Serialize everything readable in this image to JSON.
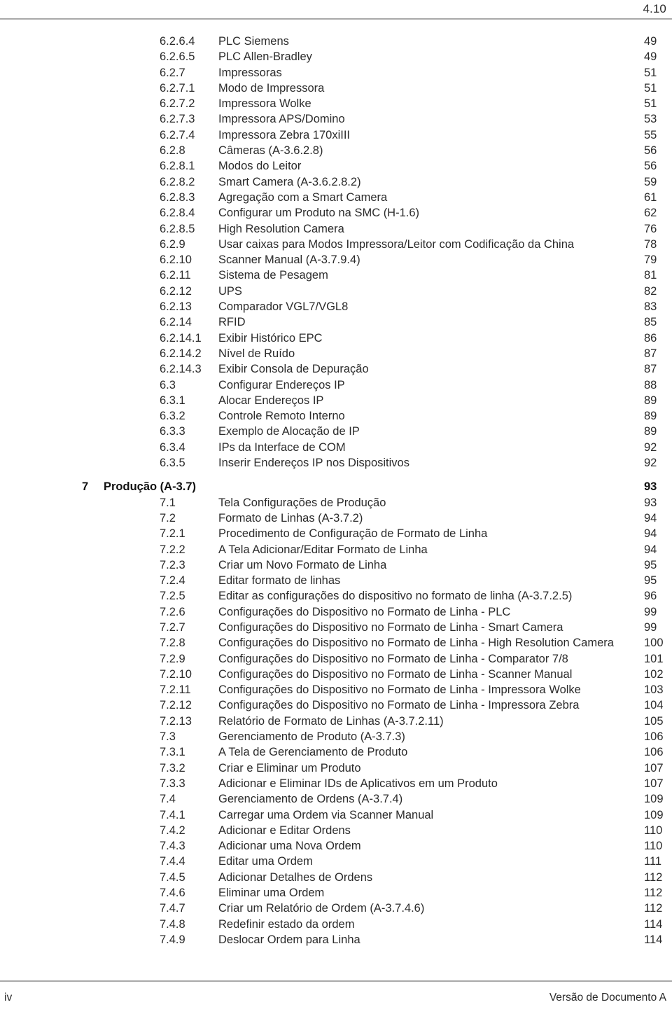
{
  "header": {
    "section_number": "4.10"
  },
  "footer": {
    "page_label": "iv",
    "document_version": "Versão de Documento A"
  },
  "toc": {
    "entries": [
      {
        "number": "6.2.6.4",
        "title": "PLC Siemens",
        "page": "49",
        "level": "entry"
      },
      {
        "number": "6.2.6.5",
        "title": "PLC Allen-Bradley",
        "page": "49",
        "level": "entry"
      },
      {
        "number": "6.2.7",
        "title": "Impressoras",
        "page": "51",
        "level": "entry"
      },
      {
        "number": "6.2.7.1",
        "title": "Modo de Impressora",
        "page": "51",
        "level": "entry"
      },
      {
        "number": "6.2.7.2",
        "title": "Impressora Wolke",
        "page": "51",
        "level": "entry"
      },
      {
        "number": "6.2.7.3",
        "title": "Impressora APS/Domino",
        "page": "53",
        "level": "entry"
      },
      {
        "number": "6.2.7.4",
        "title": "Impressora Zebra 170xiIII",
        "page": "55",
        "level": "entry"
      },
      {
        "number": "6.2.8",
        "title": "Câmeras (A-3.6.2.8)",
        "page": "56",
        "level": "entry"
      },
      {
        "number": "6.2.8.1",
        "title": "Modos do Leitor",
        "page": "56",
        "level": "entry"
      },
      {
        "number": "6.2.8.2",
        "title": "Smart Camera (A-3.6.2.8.2)",
        "page": "59",
        "level": "entry"
      },
      {
        "number": "6.2.8.3",
        "title": "Agregação com a Smart Camera",
        "page": "61",
        "level": "entry"
      },
      {
        "number": "6.2.8.4",
        "title": "Configurar um Produto na SMC (H-1.6)",
        "page": "62",
        "level": "entry"
      },
      {
        "number": "6.2.8.5",
        "title": "High Resolution Camera",
        "page": "76",
        "level": "entry"
      },
      {
        "number": "6.2.9",
        "title": "Usar caixas para Modos Impressora/Leitor com Codificação da China",
        "page": "78",
        "level": "entry"
      },
      {
        "number": "6.2.10",
        "title": "Scanner Manual (A-3.7.9.4)",
        "page": "79",
        "level": "entry"
      },
      {
        "number": "6.2.11",
        "title": "Sistema de Pesagem",
        "page": "81",
        "level": "entry"
      },
      {
        "number": "6.2.12",
        "title": "UPS",
        "page": "82",
        "level": "entry"
      },
      {
        "number": "6.2.13",
        "title": "Comparador VGL7/VGL8",
        "page": "83",
        "level": "entry"
      },
      {
        "number": "6.2.14",
        "title": "RFID",
        "page": "85",
        "level": "entry"
      },
      {
        "number": "6.2.14.1",
        "title": "Exibir Histórico EPC",
        "page": "86",
        "level": "entry"
      },
      {
        "number": "6.2.14.2",
        "title": "Nível de Ruído",
        "page": "87",
        "level": "entry"
      },
      {
        "number": "6.2.14.3",
        "title": "Exibir Consola de Depuração",
        "page": "87",
        "level": "entry"
      },
      {
        "number": "6.3",
        "title": "Configurar Endereços IP",
        "page": "88",
        "level": "entry"
      },
      {
        "number": "6.3.1",
        "title": "Alocar Endereços IP",
        "page": "89",
        "level": "entry"
      },
      {
        "number": "6.3.2",
        "title": "Controle Remoto Interno",
        "page": "89",
        "level": "entry"
      },
      {
        "number": "6.3.3",
        "title": "Exemplo de Alocação de IP",
        "page": "89",
        "level": "entry"
      },
      {
        "number": "6.3.4",
        "title": "IPs da Interface de COM",
        "page": "92",
        "level": "entry"
      },
      {
        "number": "6.3.5",
        "title": "Inserir Endereços IP nos Dispositivos",
        "page": "92",
        "level": "entry"
      },
      {
        "number": "7",
        "title": "Produção (A-3.7)",
        "page": "93",
        "level": "part"
      },
      {
        "number": "7.1",
        "title": "Tela Configurações de Produção",
        "page": "93",
        "level": "entry"
      },
      {
        "number": "7.2",
        "title": "Formato de Linhas (A-3.7.2)",
        "page": "94",
        "level": "entry"
      },
      {
        "number": "7.2.1",
        "title": "Procedimento de Configuração de Formato de Linha",
        "page": "94",
        "level": "entry"
      },
      {
        "number": "7.2.2",
        "title": "A Tela Adicionar/Editar Formato de Linha",
        "page": "94",
        "level": "entry"
      },
      {
        "number": "7.2.3",
        "title": "Criar um Novo Formato de Linha",
        "page": "95",
        "level": "entry"
      },
      {
        "number": "7.2.4",
        "title": "Editar formato de linhas",
        "page": "95",
        "level": "entry"
      },
      {
        "number": "7.2.5",
        "title": "Editar as configurações do dispositivo no formato de linha (A-3.7.2.5)",
        "page": "96",
        "level": "entry"
      },
      {
        "number": "7.2.6",
        "title": "Configurações do Dispositivo no Formato de Linha - PLC",
        "page": "99",
        "level": "entry"
      },
      {
        "number": "7.2.7",
        "title": "Configurações do Dispositivo no Formato de Linha - Smart Camera",
        "page": "99",
        "level": "entry"
      },
      {
        "number": "7.2.8",
        "title": "Configurações do Dispositivo no Formato de Linha - High Resolution Camera",
        "page": "100",
        "level": "entry"
      },
      {
        "number": "7.2.9",
        "title": "Configurações do Dispositivo no Formato de Linha - Comparator 7/8",
        "page": "101",
        "level": "entry"
      },
      {
        "number": "7.2.10",
        "title": "Configurações do Dispositivo no Formato de Linha - Scanner Manual",
        "page": "102",
        "level": "entry"
      },
      {
        "number": "7.2.11",
        "title": "Configurações do Dispositivo no Formato de Linha - Impressora Wolke",
        "page": "103",
        "level": "entry"
      },
      {
        "number": "7.2.12",
        "title": "Configurações do Dispositivo no Formato de Linha - Impressora Zebra",
        "page": "104",
        "level": "entry"
      },
      {
        "number": "7.2.13",
        "title": "Relatório de Formato de Linhas (A-3.7.2.11)",
        "page": "105",
        "level": "entry"
      },
      {
        "number": "7.3",
        "title": "Gerenciamento de Produto (A-3.7.3)",
        "page": "106",
        "level": "entry"
      },
      {
        "number": "7.3.1",
        "title": "A Tela de Gerenciamento de Produto",
        "page": "106",
        "level": "entry"
      },
      {
        "number": "7.3.2",
        "title": "Criar e Eliminar um Produto",
        "page": "107",
        "level": "entry"
      },
      {
        "number": "7.3.3",
        "title": "Adicionar e Eliminar IDs de Aplicativos em um Produto",
        "page": "107",
        "level": "entry"
      },
      {
        "number": "7.4",
        "title": "Gerenciamento de Ordens (A-3.7.4)",
        "page": "109",
        "level": "entry"
      },
      {
        "number": "7.4.1",
        "title": "Carregar uma Ordem via Scanner Manual",
        "page": "109",
        "level": "entry"
      },
      {
        "number": "7.4.2",
        "title": "Adicionar e Editar Ordens",
        "page": "110",
        "level": "entry"
      },
      {
        "number": "7.4.3",
        "title": "Adicionar uma Nova Ordem",
        "page": "110",
        "level": "entry"
      },
      {
        "number": "7.4.4",
        "title": "Editar uma Ordem",
        "page": "111",
        "level": "entry"
      },
      {
        "number": "7.4.5",
        "title": "Adicionar Detalhes de Ordens",
        "page": "112",
        "level": "entry"
      },
      {
        "number": "7.4.6",
        "title": "Eliminar uma Ordem",
        "page": "112",
        "level": "entry"
      },
      {
        "number": "7.4.7",
        "title": "Criar um Relatório de Ordem (A-3.7.4.6)",
        "page": "112",
        "level": "entry"
      },
      {
        "number": "7.4.8",
        "title": "Redefinir estado da ordem",
        "page": "114",
        "level": "entry"
      },
      {
        "number": "7.4.9",
        "title": "Deslocar Ordem para Linha",
        "page": "114",
        "level": "entry"
      }
    ]
  }
}
